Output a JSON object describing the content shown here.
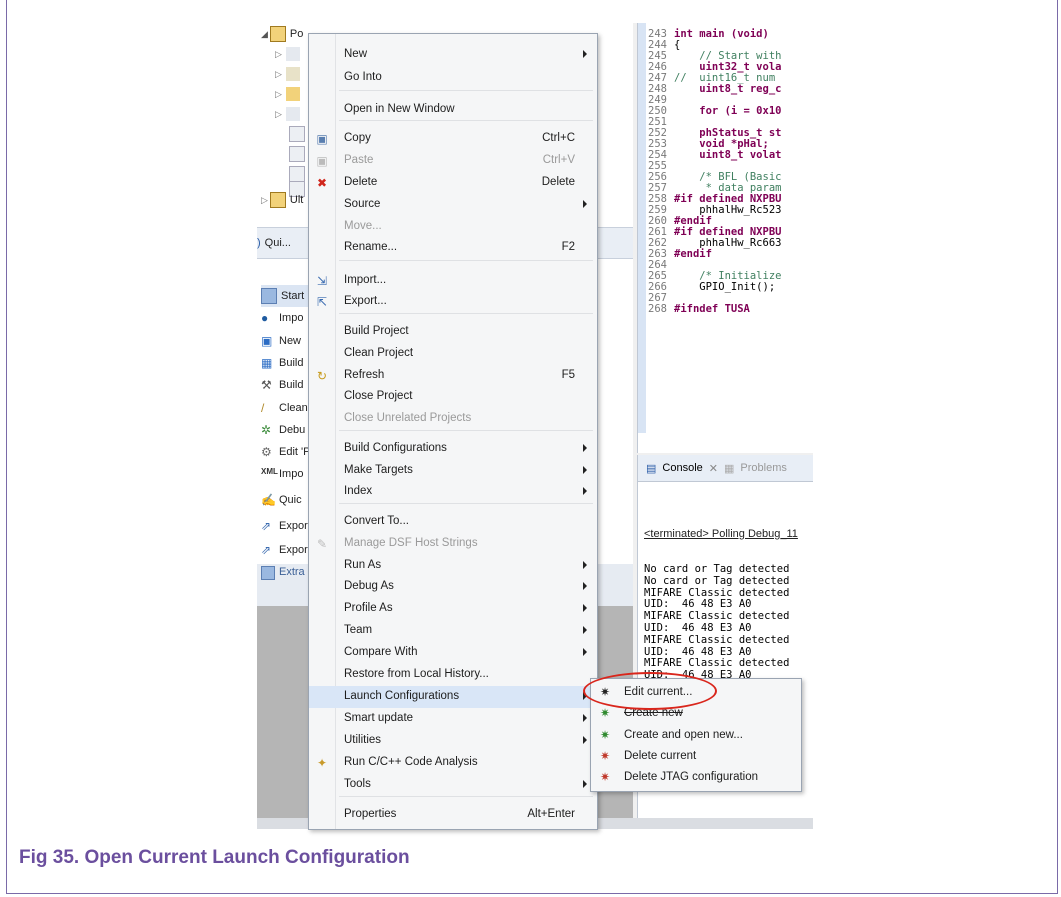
{
  "caption": "Fig 35.   Open Current Launch Configuration",
  "left_panel": {
    "tree_items": [
      "Po",
      "Ult"
    ],
    "quick": "Qui...",
    "start": "Start",
    "tasks": [
      "Impo",
      "New",
      "Build",
      "Build",
      "Clean",
      "Debu",
      "Edit 'P",
      "Impo",
      "Quic",
      "Expor",
      "Expor"
    ],
    "extra": "Extra"
  },
  "editor": {
    "lines": [
      {
        "n": "243",
        "t": "int main (void)"
      },
      {
        "n": "244",
        "t": "{"
      },
      {
        "n": "245",
        "t": "    // Start with"
      },
      {
        "n": "246",
        "t": "    uint32_t vola"
      },
      {
        "n": "247",
        "t": "//  uint16_t num"
      },
      {
        "n": "248",
        "t": "    uint8_t reg_c"
      },
      {
        "n": "249",
        "t": ""
      },
      {
        "n": "250",
        "t": "    for (i = 0x10"
      },
      {
        "n": "251",
        "t": ""
      },
      {
        "n": "252",
        "t": "    phStatus_t st"
      },
      {
        "n": "253",
        "t": "    void *pHal;"
      },
      {
        "n": "254",
        "t": "    uint8_t volat"
      },
      {
        "n": "255",
        "t": ""
      },
      {
        "n": "256",
        "t": "    /* BFL (Basic"
      },
      {
        "n": "257",
        "t": "     * data param"
      },
      {
        "n": "258",
        "t": "#if defined NXPBU"
      },
      {
        "n": "259",
        "t": "    phhalHw_Rc523"
      },
      {
        "n": "260",
        "t": "#endif"
      },
      {
        "n": "261",
        "t": "#if defined NXPBU"
      },
      {
        "n": "262",
        "t": "    phhalHw_Rc663"
      },
      {
        "n": "263",
        "t": "#endif"
      },
      {
        "n": "264",
        "t": ""
      },
      {
        "n": "265",
        "t": "    /* Initialize"
      },
      {
        "n": "266",
        "t": "    GPIO_Init();"
      },
      {
        "n": "267",
        "t": ""
      },
      {
        "n": "268",
        "t": "#ifndef TUSA"
      }
    ]
  },
  "console": {
    "tab_console": "Console",
    "tab_problems": "Problems",
    "header": "<terminated> Polling Debug_11",
    "lines": [
      "No card or Tag detected",
      "No card or Tag detected",
      "MIFARE Classic detected",
      "UID:  46 48 E3 A0",
      "MIFARE Classic detected",
      "UID:  46 48 E3 A0",
      "MIFARE Classic detected",
      "UID:  46 48 E3 A0",
      "MIFARE Classic detected",
      "UID:  46 48 E3 A0",
      "MIFARE Classic detected"
    ]
  },
  "menu": {
    "items": [
      {
        "label": "New",
        "arrow": true
      },
      {
        "label": "Go Into"
      },
      {
        "label": "Open in New Window"
      },
      {
        "label": "Copy",
        "shortcut": "Ctrl+C"
      },
      {
        "label": "Paste",
        "shortcut": "Ctrl+V",
        "disabled": true
      },
      {
        "label": "Delete",
        "shortcut": "Delete"
      },
      {
        "label": "Source",
        "arrow": true
      },
      {
        "label": "Move...",
        "disabled": true
      },
      {
        "label": "Rename...",
        "shortcut": "F2"
      },
      {
        "label": "Import..."
      },
      {
        "label": "Export..."
      },
      {
        "label": "Build Project"
      },
      {
        "label": "Clean Project"
      },
      {
        "label": "Refresh",
        "shortcut": "F5"
      },
      {
        "label": "Close Project"
      },
      {
        "label": "Close Unrelated Projects",
        "disabled": true
      },
      {
        "label": "Build Configurations",
        "arrow": true
      },
      {
        "label": "Make Targets",
        "arrow": true
      },
      {
        "label": "Index",
        "arrow": true
      },
      {
        "label": "Convert To..."
      },
      {
        "label": "Manage DSF Host Strings",
        "disabled": true
      },
      {
        "label": "Run As",
        "arrow": true
      },
      {
        "label": "Debug As",
        "arrow": true
      },
      {
        "label": "Profile As",
        "arrow": true
      },
      {
        "label": "Team",
        "arrow": true
      },
      {
        "label": "Compare With",
        "arrow": true
      },
      {
        "label": "Restore from Local History..."
      },
      {
        "label": "Launch Configurations",
        "arrow": true
      },
      {
        "label": "Smart update",
        "arrow": true
      },
      {
        "label": "Utilities",
        "arrow": true
      },
      {
        "label": "Run C/C++ Code Analysis"
      },
      {
        "label": "Tools",
        "arrow": true
      },
      {
        "label": "Properties",
        "shortcut": "Alt+Enter"
      }
    ]
  },
  "submenu": {
    "items": [
      {
        "label": "Edit current..."
      },
      {
        "label": "Create new"
      },
      {
        "label": "Create and open new..."
      },
      {
        "label": "Delete current"
      },
      {
        "label": "Delete JTAG configuration"
      }
    ]
  }
}
